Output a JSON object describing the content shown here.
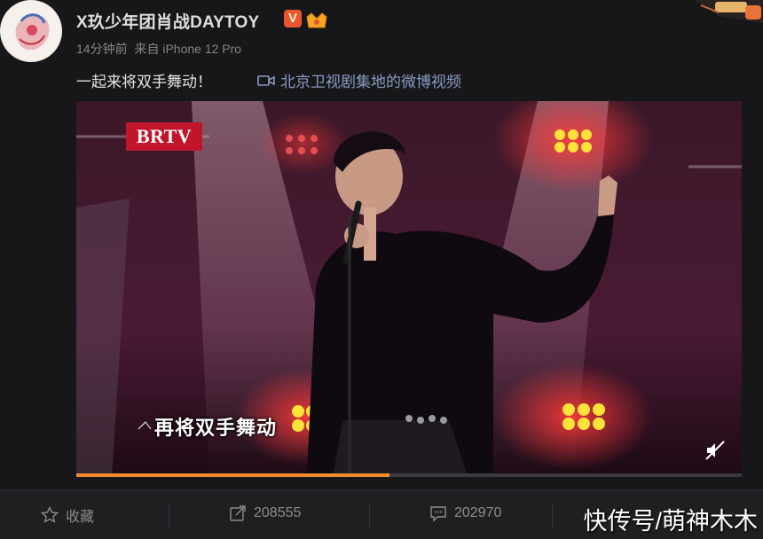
{
  "post": {
    "username": "X玖少年团肖战DAYTOY",
    "verified_badge": "V",
    "time": "14分钟前",
    "source": "来自 iPhone 12 Pro",
    "text": "一起来将双手舞动！",
    "video_link": "北京卫视剧集地的微博视频"
  },
  "video": {
    "channel_logo": "BRTV",
    "subtitle": "再将双手舞动",
    "progress": 0.47,
    "muted": true
  },
  "actions": {
    "favorite_label": "收藏",
    "repost_count": "208555",
    "comment_count": "202970"
  },
  "watermark": "快传号/萌神木木",
  "colors": {
    "background": "#17171a",
    "progress": "#f28b2c",
    "link": "#8a9ac0",
    "logo": "#c0152a"
  }
}
